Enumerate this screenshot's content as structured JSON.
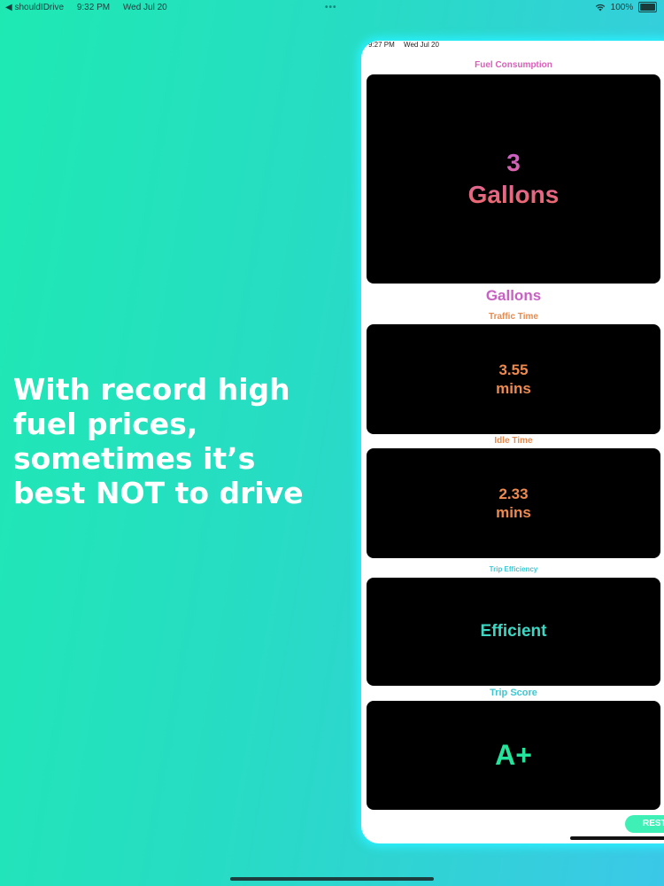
{
  "status_bar": {
    "back_app": "◀ shouldIDrive",
    "time": "9:32 PM",
    "date": "Wed Jul 20",
    "dots": "•••",
    "battery": "100%"
  },
  "promo": {
    "headline": "With record high fuel prices, sometimes it’s best NOT to drive"
  },
  "device": {
    "status_time": "9:27 PM",
    "status_date": "Wed Jul 20",
    "status_dots": "••",
    "fuel": {
      "label": "Fuel Consumption",
      "value": "3",
      "unit": "Gallons",
      "subtitle": "Gallons"
    },
    "traffic": {
      "label": "Traffic Time",
      "value": "3.55",
      "unit": "mins"
    },
    "idle": {
      "label": "Idle Time",
      "value": "2.33",
      "unit": "mins"
    },
    "efficiency": {
      "label": "Trip Efficiency",
      "value": "Efficient"
    },
    "score": {
      "label": "Trip Score",
      "value": "A+"
    },
    "reset_label": "REST"
  },
  "colors": {
    "background_start": "#1ee9b3",
    "background_end": "#3bc8e8",
    "device_glow": "#2af0ff",
    "fuel_gradient": [
      "#c65fd0",
      "#f06a66"
    ],
    "traffic": "#ee8a4e",
    "efficient": "#3cd6c3",
    "score": "#24e39a",
    "reset_button": "#3ef0b6"
  }
}
